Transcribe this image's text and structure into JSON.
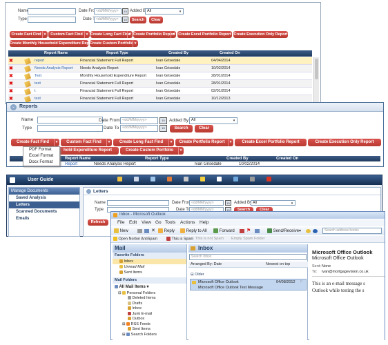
{
  "search_form": {
    "name_label": "Name",
    "type_label": "Type",
    "date_from_label": "Date From",
    "date_to_label": "Date To",
    "added_by_label": "Added By",
    "date_placeholder": "<dd/MM/yyyy>",
    "added_by_value": "All",
    "search_label": "Search",
    "clear_label": "Clear"
  },
  "actions": {
    "create_fact_find": "Create Fact Find",
    "custom_fact_find": "Custom Fact Find",
    "create_long_fact_find": "Create Long Fact Find",
    "create_portfolio_report": "Create Portfolio Report",
    "create_excel_portfolio_report": "Create Excel Portfolio Report",
    "create_execution_only_report": "Create Execution Only Report",
    "create_monthly_household_report": "Create Monthly Household Expenditure Report",
    "create_custom_portfolio": "Create Custom Portfolio",
    "household_partial": "hold Expenditure Report"
  },
  "table": {
    "headers": [
      "Report Name",
      "Report Type",
      "Created By",
      "Created On"
    ],
    "rows": [
      [
        "report",
        "Financial Statement Full Report",
        "Ivan  Grisedale",
        "04/04/2014"
      ],
      [
        "Needs Analysis Report",
        "Needs Analysis Report",
        "Ivan  Grisedale",
        "10/02/2014"
      ],
      [
        "Test",
        "Monthly Household Expenditure Report",
        "Ivan  Grisedale",
        "28/01/2014"
      ],
      [
        "test",
        "Financial Statement Full Report",
        "Ivan  Grisedale",
        "28/01/2014"
      ],
      [
        "t",
        "Financial Statement Full Report",
        "Ivan  Grisedale",
        "02/01/2014"
      ],
      [
        "test",
        "Financial Statement Full Report",
        "Ivan  Grisedale",
        "10/12/2013"
      ]
    ],
    "partial_row": [
      "Report",
      "Needs Analysis Report",
      "Ivan  Grisedale",
      "10/02/2014"
    ]
  },
  "reports_panel": {
    "title": "Reports"
  },
  "format_menu": [
    "PDF Format",
    "Excel Format",
    "Docx Format"
  ],
  "app": {
    "title": "User Guide",
    "sidebar_header": "Manage Documents",
    "sidebar_items": [
      "Saved Analysis",
      "Letters",
      "Scanned Documents",
      "Emails"
    ],
    "section_title": "Letters",
    "refresh_label": "Refresh"
  },
  "outlook": {
    "title": "Inbox - Microsoft Outlook",
    "menu": [
      "File",
      "Edit",
      "View",
      "Go",
      "Tools",
      "Actions",
      "Help"
    ],
    "toolbar": [
      "New",
      "Reply",
      "Reply to All",
      "Forward",
      "Send/Receive"
    ],
    "search_books_placeholder": "Search address books",
    "norton": [
      "Open Norton AntiSpam",
      "This is Spam",
      "This is not Spam",
      "Empty Spam Folder"
    ],
    "mail_header": "Mail",
    "favorite_folders_header": "Favorite Folders",
    "favorites": [
      "Inbox",
      "Unread Mail",
      "Sent Items"
    ],
    "mail_folders_header": "Mail Folders",
    "all_mail_items": "All Mail Items",
    "personal_folders": "Personal Folders",
    "folders": [
      "Deleted Items",
      "Drafts",
      "Inbox",
      "Junk E-mail",
      "Outbox",
      "RSS Feeds",
      "Sent Items",
      "Search Folders"
    ],
    "inbox_title": "Inbox",
    "search_inbox_placeholder": "Search Inbox",
    "arranged_by": "Arranged By: Date",
    "newest_on_top": "Newest on top",
    "older_group": "Older",
    "message_from": "Microsoft Office Outlook",
    "message_date": "04/08/2012",
    "message_subject": "Microsoft Office Outlook Test Message",
    "preview_title": "Microsoft Office Outlook",
    "preview_title2": "Microsoft Office Outlook",
    "sent_label": "Sent:",
    "sent_value": "None",
    "to_label": "To:",
    "to_value": "ivan@mortgagevision.co.uk",
    "body_line1": "This is an e-mail message s",
    "body_line2": "Outlook while testing the s"
  }
}
